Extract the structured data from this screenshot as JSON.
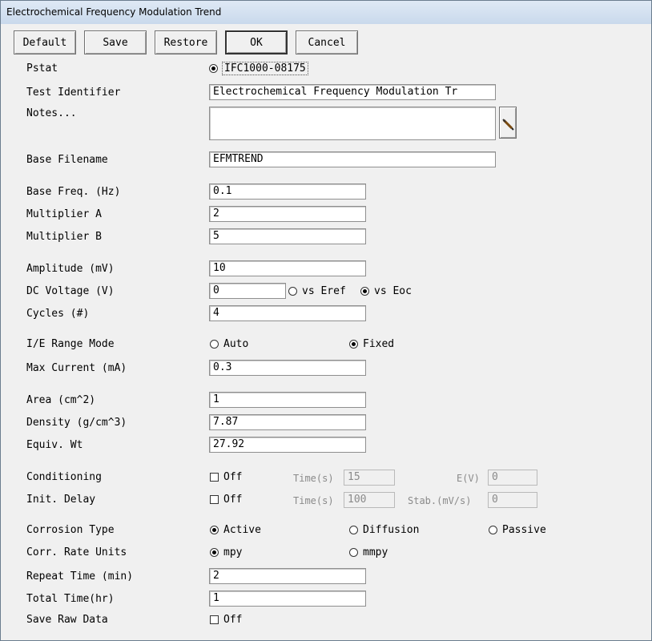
{
  "window": {
    "title": "Electrochemical Frequency Modulation Trend"
  },
  "buttons": {
    "default": "Default",
    "save": "Save",
    "restore": "Restore",
    "ok": "OK",
    "cancel": "Cancel"
  },
  "labels": {
    "pstat": "Pstat",
    "test_identifier": "Test Identifier",
    "notes": "Notes...",
    "base_filename": "Base Filename",
    "base_freq": "Base Freq. (Hz)",
    "multiplier_a": "Multiplier A",
    "multiplier_b": "Multiplier B",
    "amplitude": "Amplitude (mV)",
    "dc_voltage": "DC Voltage (V)",
    "cycles": "Cycles (#)",
    "ie_range_mode": "I/E Range Mode",
    "max_current": "Max Current (mA)",
    "area": "Area (cm^2)",
    "density": "Density (g/cm^3)",
    "equiv_wt": "Equiv. Wt",
    "conditioning": "Conditioning",
    "init_delay": "Init. Delay",
    "corrosion_type": "Corrosion Type",
    "corr_rate_units": "Corr. Rate Units",
    "repeat_time": "Repeat Time (min)",
    "total_time": "Total Time(hr)",
    "save_raw_data": "Save Raw Data"
  },
  "values": {
    "pstat": "IFC1000-08175",
    "test_identifier": "Electrochemical Frequency Modulation Tr",
    "notes": "",
    "base_filename": "EFMTREND",
    "base_freq": "0.1",
    "multiplier_a": "2",
    "multiplier_b": "5",
    "amplitude": "10",
    "dc_voltage": "0",
    "cycles": "4",
    "max_current": "0.3",
    "area": "1",
    "density": "7.87",
    "equiv_wt": "27.92",
    "conditioning_time": "15",
    "conditioning_e": "0",
    "init_delay_time": "100",
    "init_delay_stab": "0",
    "repeat_time": "2",
    "total_time": "1"
  },
  "options": {
    "vs_eref": "vs Eref",
    "vs_eoc": "vs Eoc",
    "auto": "Auto",
    "fixed": "Fixed",
    "off": "Off",
    "time_s": "Time(s)",
    "e_v": "E(V)",
    "stab": "Stab.(mV/s)",
    "active": "Active",
    "diffusion": "Diffusion",
    "passive": "Passive",
    "mpy": "mpy",
    "mmpy": "mmpy"
  },
  "icons": {
    "notes_edit": "pen-icon"
  }
}
